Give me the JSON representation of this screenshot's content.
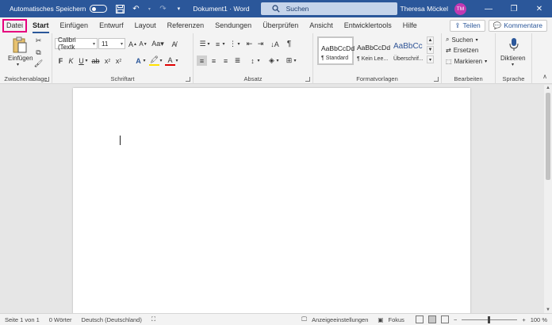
{
  "titlebar": {
    "autosave_label": "Automatisches Speichern",
    "title": "Dokument1 · Word",
    "search_placeholder": "Suchen",
    "user_name": "Theresa Möckel",
    "user_initials": "TM"
  },
  "menu": {
    "tabs": [
      "Datei",
      "Start",
      "Einfügen",
      "Entwurf",
      "Layout",
      "Referenzen",
      "Sendungen",
      "Überprüfen",
      "Ansicht",
      "Entwicklertools",
      "Hilfe"
    ],
    "share_label": "Teilen",
    "comments_label": "Kommentare"
  },
  "ribbon": {
    "clipboard": {
      "paste_label": "Einfügen",
      "group_label": "Zwischenablage"
    },
    "font": {
      "font_name": "Calibri (Textk",
      "font_size": "11",
      "group_label": "Schriftart"
    },
    "paragraph": {
      "group_label": "Absatz"
    },
    "styles": {
      "items": [
        {
          "sample": "AaBbCcDd",
          "name": "¶ Standard"
        },
        {
          "sample": "AaBbCcDd",
          "name": "¶ Kein Lee..."
        },
        {
          "sample": "AaBbCc",
          "name": "Überschrif..."
        }
      ],
      "group_label": "Formatvorlagen"
    },
    "editing": {
      "search": "Suchen",
      "replace": "Ersetzen",
      "select": "Markieren",
      "group_label": "Bearbeiten"
    },
    "voice": {
      "dictate": "Diktieren",
      "group_label": "Sprache"
    }
  },
  "status": {
    "page": "Seite 1 von 1",
    "words": "0 Wörter",
    "language": "Deutsch (Deutschland)",
    "display_settings": "Anzeigeeinstellungen",
    "focus": "Fokus",
    "zoom": "100 %"
  },
  "colors": {
    "accent": "#2b579a",
    "datei_highlight": "#e6007e",
    "avatar": "#c239b3"
  }
}
